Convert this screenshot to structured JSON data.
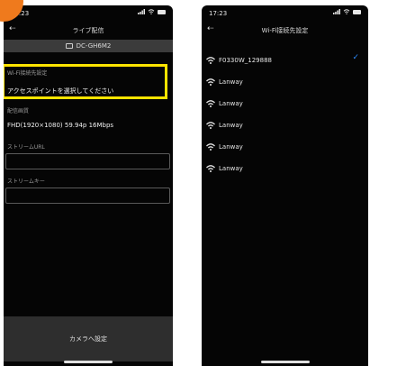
{
  "left_screen": {
    "status_time": "17:23",
    "nav_title": "ライブ配信",
    "camera_name": "DC-GH6M2",
    "wifi_label": "Wi-Fi接続先設定",
    "wifi_value": "アクセスポイントを選択してください",
    "quality_label": "配信画質",
    "quality_value": "FHD(1920×1080) 59.94p 16Mbps",
    "stream_url_label": "ストリームURL",
    "stream_url_value": "",
    "stream_key_label": "ストリームキー",
    "stream_key_value": "",
    "set_button_label": "カメラへ設定"
  },
  "right_screen": {
    "status_time": "17:23",
    "nav_title": "Wi-Fi接続先設定",
    "networks": [
      {
        "name": "F0330W_129888",
        "selected": true
      },
      {
        "name": "Lanway",
        "selected": false
      },
      {
        "name": "Lanway",
        "selected": false
      },
      {
        "name": "Lanway",
        "selected": false
      },
      {
        "name": "Lanway",
        "selected": false
      },
      {
        "name": "Lanway",
        "selected": false
      }
    ],
    "check_mark": "✓"
  },
  "icons": {
    "back": "back-arrow-icon",
    "camera": "camera-icon",
    "wifi": "wifi-icon",
    "signal": "signal-icon",
    "battery": "battery-icon"
  },
  "colors": {
    "highlight": "#ffe400",
    "badge": "#ef7a1d",
    "check": "#2d8cff",
    "screen_bg": "#050505"
  }
}
